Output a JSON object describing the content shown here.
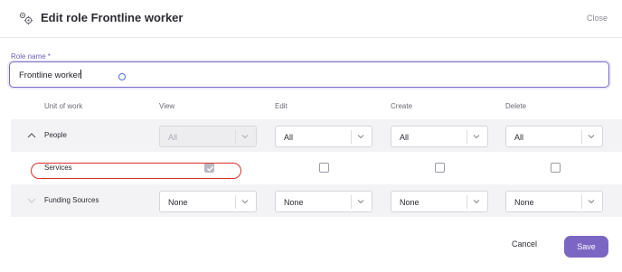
{
  "header": {
    "title": "Edit role Frontline worker",
    "close_label": "Close",
    "icon": "roles-gear-icon"
  },
  "role_name": {
    "label": "Role name *",
    "value": "Frontline worker"
  },
  "table": {
    "columns": [
      "Unit of work",
      "View",
      "Edit",
      "Create",
      "Delete"
    ],
    "rows": [
      {
        "name": "People",
        "chevron": "chevron-up-icon",
        "view": "All",
        "edit": "All",
        "create": "All",
        "delete": "All"
      },
      {
        "name": "Services",
        "view_checked": true,
        "edit_checked": false,
        "create_checked": false,
        "delete_checked": false
      },
      {
        "name": "Funding Sources",
        "chevron": "chevron-down-icon",
        "view": "None",
        "edit": "None",
        "create": "None",
        "delete": "None"
      }
    ]
  },
  "footer": {
    "cancel_label": "Cancel",
    "save_label": "Save"
  },
  "colors": {
    "accent": "#7c66c4",
    "annotation": "#d9302c"
  }
}
